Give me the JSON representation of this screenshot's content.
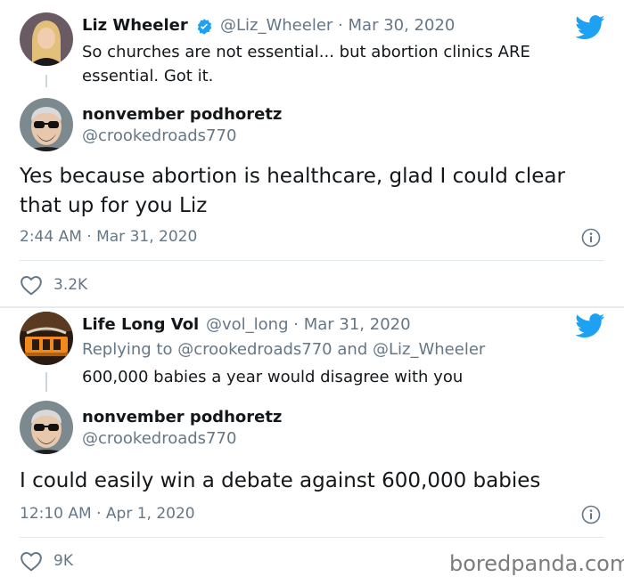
{
  "tweet1": {
    "quoted": {
      "name": "Liz Wheeler",
      "verified": true,
      "handle": "@Liz_Wheeler",
      "date": "Mar 30, 2020",
      "text": "So churches are not essential... but abortion clinics ARE essential. Got it."
    },
    "reply": {
      "name": "nonvember podhoretz",
      "handle": "@crookedroads770",
      "text": "Yes because abortion is healthcare, glad I could clear that up for you Liz",
      "timestamp": "2:44 AM · Mar 31, 2020",
      "likes": "3.2K"
    }
  },
  "tweet2": {
    "quoted": {
      "name": "Life Long Vol",
      "handle": "@vol_long",
      "date": "Mar 31, 2020",
      "replying_prefix": "Replying to",
      "replying_to_1": "@crookedroads770",
      "replying_and": "and",
      "replying_to_2": "@Liz_Wheeler",
      "text": "600,000 babies a year would disagree with you"
    },
    "reply": {
      "name": "nonvember podhoretz",
      "handle": "@crookedroads770",
      "text": "I could easily win a debate against 600,000 babies",
      "timestamp": "12:10 AM · Apr 1, 2020",
      "likes": "9K"
    }
  },
  "watermark": "boredpanda.com",
  "separator": "·",
  "icons": {
    "brand": "twitter-bird-icon",
    "verified": "verified-badge-icon",
    "info": "info-icon",
    "like": "heart-icon"
  },
  "colors": {
    "twitter_blue": "#1da1f2",
    "muted": "#657786",
    "link": "#1b95e0"
  }
}
